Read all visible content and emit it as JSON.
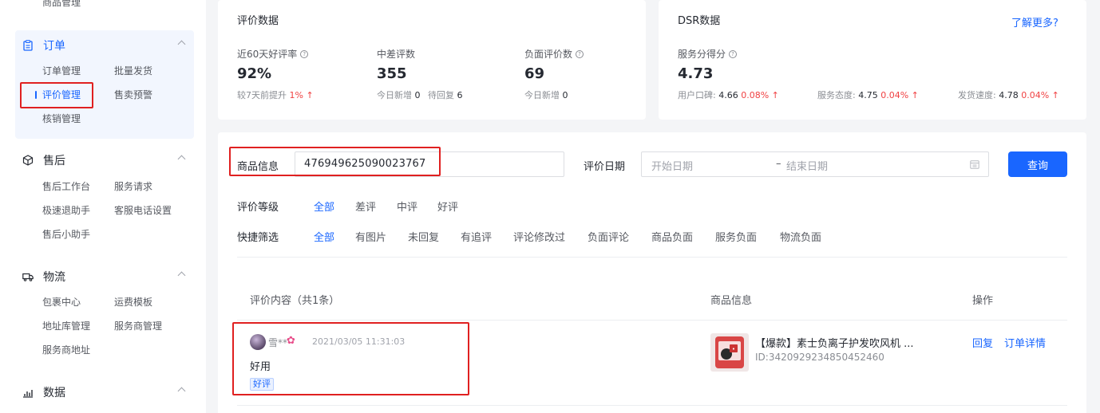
{
  "sidebar": {
    "top_cut_item": "商品管理",
    "groups": [
      {
        "title": "订单",
        "icon": "clipboard-icon",
        "items": [
          "订单管理",
          "批量发货",
          "评价管理",
          "售卖预警",
          "核销管理"
        ]
      },
      {
        "title": "售后",
        "icon": "box-icon",
        "items": [
          "售后工作台",
          "服务请求",
          "极速退助手",
          "客服电话设置",
          "售后小助手"
        ]
      },
      {
        "title": "物流",
        "icon": "truck-icon",
        "items": [
          "包裹中心",
          "运费模板",
          "地址库管理",
          "服务商管理",
          "服务商地址"
        ]
      },
      {
        "title": "数据",
        "icon": "bar-chart-icon",
        "items": []
      }
    ]
  },
  "review_stats": {
    "title": "评价数据",
    "metrics": [
      {
        "label": "近60天好评率",
        "value": "92%",
        "sub_label": "较7天前提升",
        "sub_value": "1%"
      },
      {
        "label": "中差评数",
        "value": "355",
        "sub_label1": "今日新增",
        "sub_value1": "0",
        "sub_label2": "待回复",
        "sub_value2": "6"
      },
      {
        "label": "负面评价数",
        "value": "69",
        "sub_label": "今日新增",
        "sub_value": "0"
      }
    ]
  },
  "dsr": {
    "title": "DSR数据",
    "learn_more": "了解更多?",
    "score_label": "服务分得分",
    "score_value": "4.73",
    "subs": [
      {
        "label": "用户口碑:",
        "value": "4.66",
        "change": "0.08%"
      },
      {
        "label": "服务态度:",
        "value": "4.75",
        "change": "0.04%"
      },
      {
        "label": "发货速度:",
        "value": "4.78",
        "change": "0.04%"
      }
    ]
  },
  "filters": {
    "product_label": "商品信息",
    "product_value": "476949625090023767",
    "date_label": "评价日期",
    "start_placeholder": "开始日期",
    "separator": "–",
    "end_placeholder": "结束日期",
    "query_button": "查询",
    "level_label": "评价等级",
    "level_options": [
      "全部",
      "差评",
      "中评",
      "好评"
    ],
    "quick_label": "快捷筛选",
    "quick_options": [
      "全部",
      "有图片",
      "未回复",
      "有追评",
      "评论修改过",
      "负面评论",
      "商品负面",
      "服务负面",
      "物流负面"
    ]
  },
  "table": {
    "col_content": "评价内容（共1条）",
    "col_product": "商品信息",
    "col_action": "操作",
    "rows": [
      {
        "user": "雪**",
        "time": "2021/03/05 11:31:03",
        "content": "好用",
        "tag": "好评",
        "product_name": "【爆款】素士负离子护发吹风机 ...",
        "product_id": "ID:3420929234850452460",
        "actions": [
          "回复",
          "订单详情"
        ]
      }
    ]
  },
  "colors": {
    "accent": "#1966ff",
    "highlight_box": "#e02020",
    "up_red": "#f04142"
  }
}
